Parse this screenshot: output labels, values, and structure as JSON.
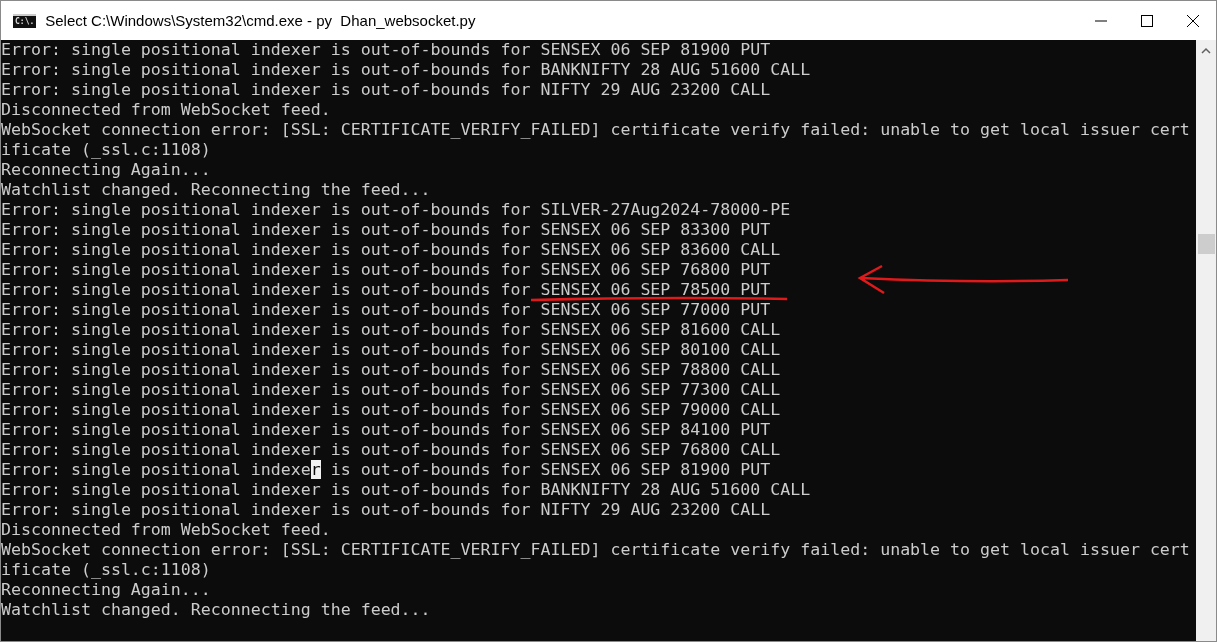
{
  "window": {
    "title": "Select C:\\Windows\\System32\\cmd.exe - py  Dhan_websocket.py",
    "icon_text": "C:\\."
  },
  "console": {
    "lines": [
      {
        "text": "Error: single positional indexer is out-of-bounds for SENSEX 06 SEP 81900 PUT"
      },
      {
        "text": "Error: single positional indexer is out-of-bounds for BANKNIFTY 28 AUG 51600 CALL"
      },
      {
        "text": "Error: single positional indexer is out-of-bounds for NIFTY 29 AUG 23200 CALL"
      },
      {
        "text": "Disconnected from WebSocket feed."
      },
      {
        "text": "WebSocket connection error: [SSL: CERTIFICATE_VERIFY_FAILED] certificate verify failed: unable to get local issuer cert"
      },
      {
        "text": "ificate (_ssl.c:1108)"
      },
      {
        "text": "Reconnecting Again..."
      },
      {
        "text": "Watchlist changed. Reconnecting the feed..."
      },
      {
        "text": "Error: single positional indexer is out-of-bounds for SILVER-27Aug2024-78000-PE"
      },
      {
        "text": "Error: single positional indexer is out-of-bounds for SENSEX 06 SEP 83300 PUT"
      },
      {
        "text": "Error: single positional indexer is out-of-bounds for SENSEX 06 SEP 83600 CALL"
      },
      {
        "text": "Error: single positional indexer is out-of-bounds for SENSEX 06 SEP 76800 PUT"
      },
      {
        "text": "Error: single positional indexer is out-of-bounds for SENSEX 06 SEP 78500 PUT",
        "marked": true
      },
      {
        "text": "Error: single positional indexer is out-of-bounds for SENSEX 06 SEP 77000 PUT"
      },
      {
        "text": "Error: single positional indexer is out-of-bounds for SENSEX 06 SEP 81600 CALL"
      },
      {
        "text": "Error: single positional indexer is out-of-bounds for SENSEX 06 SEP 80100 CALL"
      },
      {
        "text": "Error: single positional indexer is out-of-bounds for SENSEX 06 SEP 78800 CALL"
      },
      {
        "text": "Error: single positional indexer is out-of-bounds for SENSEX 06 SEP 77300 CALL"
      },
      {
        "text": "Error: single positional indexer is out-of-bounds for SENSEX 06 SEP 79000 CALL"
      },
      {
        "text": "Error: single positional indexer is out-of-bounds for SENSEX 06 SEP 84100 PUT"
      },
      {
        "text": "Error: single positional indexer is out-of-bounds for SENSEX 06 SEP 76800 CALL"
      },
      {
        "before": "Error: single positional indexe",
        "cursor": "r",
        "after": " is out-of-bounds for SENSEX 06 SEP 81900 PUT"
      },
      {
        "text": "Error: single positional indexer is out-of-bounds for BANKNIFTY 28 AUG 51600 CALL"
      },
      {
        "text": "Error: single positional indexer is out-of-bounds for NIFTY 29 AUG 23200 CALL"
      },
      {
        "text": "Disconnected from WebSocket feed."
      },
      {
        "text": "WebSocket connection error: [SSL: CERTIFICATE_VERIFY_FAILED] certificate verify failed: unable to get local issuer cert"
      },
      {
        "text": "ificate (_ssl.c:1108)"
      },
      {
        "text": "Reconnecting Again..."
      },
      {
        "text": "Watchlist changed. Reconnecting the feed..."
      }
    ]
  }
}
